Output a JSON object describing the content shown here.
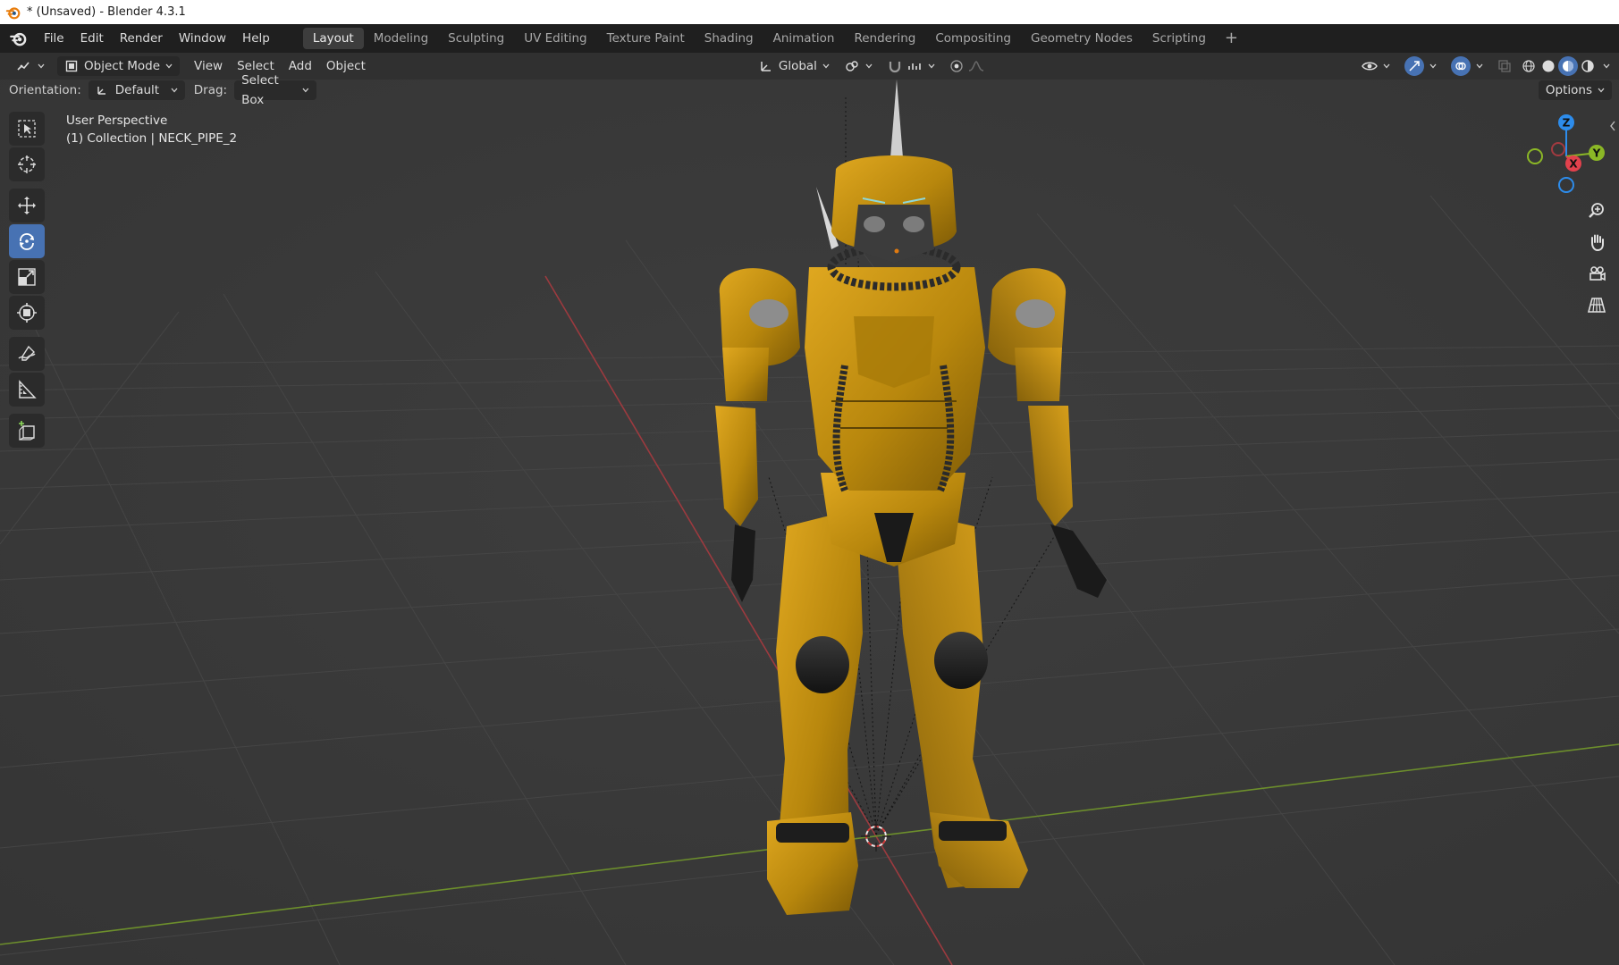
{
  "window": {
    "title": "* (Unsaved) - Blender 4.3.1"
  },
  "menu": [
    "File",
    "Edit",
    "Render",
    "Window",
    "Help"
  ],
  "workspaces": {
    "tabs": [
      "Layout",
      "Modeling",
      "Sculpting",
      "UV Editing",
      "Texture Paint",
      "Shading",
      "Animation",
      "Rendering",
      "Compositing",
      "Geometry Nodes",
      "Scripting"
    ],
    "active": "Layout",
    "add_label": "+"
  },
  "viewport_header": {
    "mode": "Object Mode",
    "menus": [
      "View",
      "Select",
      "Add",
      "Object"
    ],
    "transform_orientation": "Global"
  },
  "tool_settings": {
    "orientation_label": "Orientation:",
    "orientation_value": "Default",
    "drag_label": "Drag:",
    "drag_value": "Select Box",
    "options_label": "Options"
  },
  "viewport": {
    "perspective": "User Perspective",
    "collection_info": "(1) Collection | NECK_PIPE_2"
  },
  "gizmo": {
    "x_label": "X",
    "y_label": "Y",
    "z_label": "Z"
  },
  "colors": {
    "accent": "#4772b3",
    "armor": "#c4930f",
    "x_axis": "#e2414c",
    "y_axis": "#8bb726",
    "z_axis": "#2d8ceb"
  }
}
